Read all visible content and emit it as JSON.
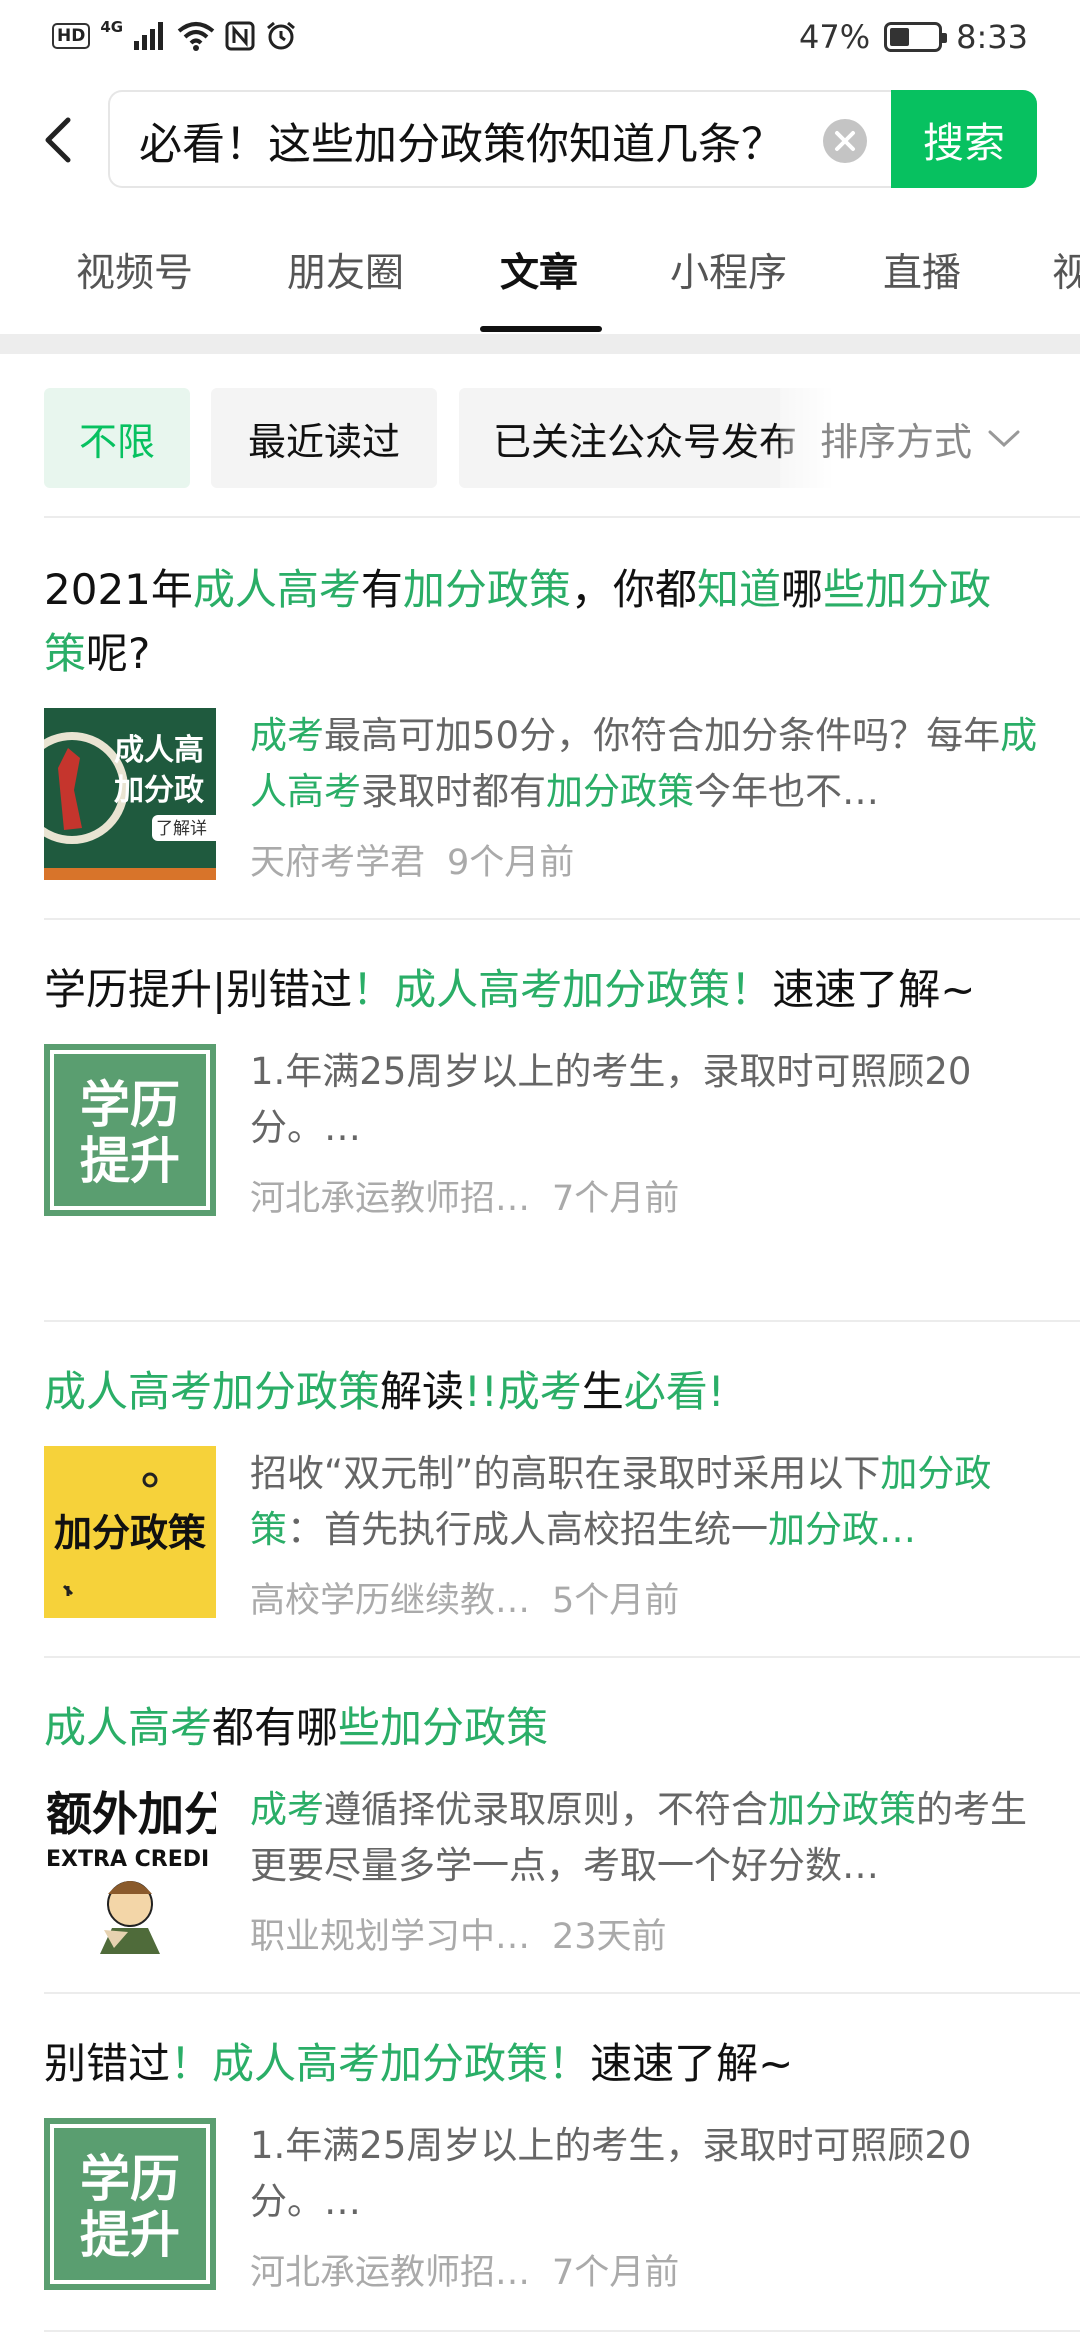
{
  "status_bar": {
    "network": "4G",
    "battery": "47%",
    "battery_level": 0.47,
    "time": "8:33"
  },
  "search": {
    "query": "必看！这些加分政策你知道几条？",
    "button_label": "搜索"
  },
  "tabs": [
    "视频号",
    "朋友圈",
    "文章",
    "小程序",
    "直播",
    "视"
  ],
  "active_tab": "文章",
  "filters": [
    "不限",
    "最近读过",
    "已关注公众号发布"
  ],
  "sort_label": "排序方式",
  "colors": {
    "accent": "#07c160",
    "highlight": "#2aae67"
  },
  "results": [
    {
      "title": [
        {
          "t": "2021年",
          "h": false
        },
        {
          "t": "成人高考",
          "h": true
        },
        {
          "t": "有",
          "h": false
        },
        {
          "t": "加分政策",
          "h": true
        },
        {
          "t": "，你都",
          "h": false
        },
        {
          "t": "知道",
          "h": true
        },
        {
          "t": "哪",
          "h": false
        },
        {
          "t": "些加分政策",
          "h": true
        },
        {
          "t": "呢?",
          "h": false
        }
      ],
      "snippet": [
        {
          "t": "成考",
          "h": true
        },
        {
          "t": "最高可加50分，你符合加分条件吗？每年",
          "h": false
        },
        {
          "t": "成人高考",
          "h": true
        },
        {
          "t": "录取时都有",
          "h": false
        },
        {
          "t": "加分政策",
          "h": true
        },
        {
          "t": "今年也不…",
          "h": false
        }
      ],
      "source": "天府考学君",
      "time": "9个月前",
      "thumb": {
        "lines": [
          "成人高",
          "加分政"
        ],
        "tag": "了解详"
      }
    },
    {
      "title": [
        {
          "t": "学历提升|别错过",
          "h": false
        },
        {
          "t": "！",
          "h": true
        },
        {
          "t": "成人高考加分政策",
          "h": true
        },
        {
          "t": "！",
          "h": true
        },
        {
          "t": "速速了解~",
          "h": false
        }
      ],
      "snippet": [
        {
          "t": "1.年满25周岁以上的考生，录取时可照顾20分。…",
          "h": false
        }
      ],
      "source": "河北承运教师招…",
      "time": "7个月前",
      "thumb": {
        "lines": [
          "学历",
          "提升"
        ]
      }
    },
    {
      "title": [
        {
          "t": "成人高考加分政策",
          "h": true
        },
        {
          "t": "解读",
          "h": false
        },
        {
          "t": "!!成考",
          "h": true
        },
        {
          "t": "生",
          "h": false
        },
        {
          "t": "必看!",
          "h": true
        }
      ],
      "snippet": [
        {
          "t": "招收“双元制”的高职在录取时采用以下",
          "h": false
        },
        {
          "t": "加分政策",
          "h": true
        },
        {
          "t": "：首先执行成人高校招生统一",
          "h": false
        },
        {
          "t": "加分政…",
          "h": true
        }
      ],
      "source": "高校学历继续教…",
      "time": "5个月前",
      "thumb": {
        "lines": [
          "加分政策"
        ]
      }
    },
    {
      "title": [
        {
          "t": "成人高考",
          "h": true
        },
        {
          "t": "都有哪",
          "h": false
        },
        {
          "t": "些加分政策",
          "h": true
        }
      ],
      "snippet": [
        {
          "t": "成考",
          "h": true
        },
        {
          "t": "遵循择优录取原则，不符合",
          "h": false
        },
        {
          "t": "加分政策",
          "h": true
        },
        {
          "t": "的考生更要尽量多学一点，考取一个好分数…",
          "h": false
        }
      ],
      "source": "职业规划学习中…",
      "time": "23天前",
      "thumb": {
        "lines": [
          "额外加分",
          "EXTRA CREDI"
        ]
      }
    },
    {
      "title": [
        {
          "t": "别错过",
          "h": false
        },
        {
          "t": "！",
          "h": true
        },
        {
          "t": "成人高考加分政策",
          "h": true
        },
        {
          "t": "！",
          "h": true
        },
        {
          "t": "速速了解~",
          "h": false
        }
      ],
      "snippet": [
        {
          "t": "1.年满25周岁以上的考生，录取时可照顾20分。…",
          "h": false
        }
      ],
      "source": "河北承运教师招…",
      "time": "7个月前",
      "thumb": {
        "lines": [
          "学历",
          "提升"
        ]
      }
    }
  ]
}
